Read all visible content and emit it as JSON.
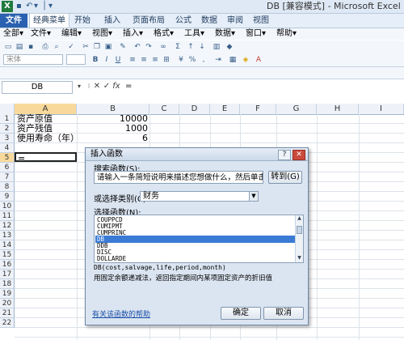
{
  "app": {
    "title": "DB [兼容模式] - Microsoft Excel",
    "icon": "excel-icon",
    "brand_color": "#2a61b0"
  },
  "quick_access": [
    "↶",
    "▾",
    "│",
    "▾"
  ],
  "ribbon_tabs": [
    "文件",
    "经典菜单",
    "开始",
    "插入",
    "页面布局",
    "公式",
    "数据",
    "审阅",
    "视图"
  ],
  "classic_menu": [
    "全部",
    "文件",
    "编辑",
    "视图",
    "插入",
    "格式",
    "工具",
    "数据",
    "窗口",
    "帮助"
  ],
  "toolbar": {
    "font_name": "宋体"
  },
  "formula_bar": {
    "name_box": "DB",
    "cancel": "✕",
    "enter": "✓",
    "fx": "fx",
    "content": "="
  },
  "grid": {
    "columns": [
      "A",
      "B",
      "C",
      "D",
      "E",
      "F",
      "G",
      "H",
      "I"
    ],
    "rows": [
      "1",
      "2",
      "3",
      "4",
      "5",
      "6",
      "7",
      "8",
      "9",
      "10",
      "11",
      "12",
      "13",
      "14",
      "15",
      "16",
      "17",
      "18",
      "19",
      "20",
      "21",
      "22"
    ],
    "cells": [
      {
        "label": "资产原值",
        "value": "10000"
      },
      {
        "label": "资产残值",
        "value": "1000"
      },
      {
        "label": "使用寿命（年）",
        "value": "6"
      }
    ],
    "active_cell_content": "="
  },
  "dialog": {
    "title": "插入函数",
    "help_btn": "?",
    "close_btn": "✕",
    "search_label": "搜索函数(S):",
    "search_text": "请输入一条简短说明来描述您想做什么，然后单击“转到”",
    "go_button": "转到(G)",
    "category_label": "或选择类别(C):",
    "category_value": "财务",
    "list_label": "选择函数(N):",
    "functions": [
      "COUPPCD",
      "CUMIPMT",
      "CUMPRINC",
      "DB",
      "DDB",
      "DISC",
      "DOLLARDE"
    ],
    "selected_function": "DB",
    "signature": "DB(cost,salvage,life,period,month)",
    "description": "用固定余额递减法，返回指定期间内某项固定资产的折旧值",
    "help_link": "有关该函数的帮助",
    "ok_button": "确定",
    "cancel_button": "取消"
  }
}
